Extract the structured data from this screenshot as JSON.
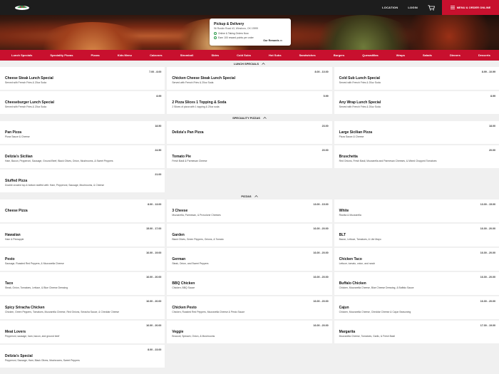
{
  "header": {
    "nav": [
      "LOCATION",
      "LOGIN"
    ],
    "order_button": "MENU & ORDER ONLINE",
    "icons": {
      "cart": "cart-icon",
      "menu": "menu-lines-icon",
      "logo": "pizza-logo"
    }
  },
  "pickup": {
    "title": "Pickup & Delivery",
    "address": "96 Ruskin Road #3, Winsboro, OK 19999",
    "status": "Online & Taking Orders Now",
    "rewards": "Earn 100 reward points per order",
    "rewards_link": "Our Rewards"
  },
  "categories": [
    "Lunch Specials",
    "Speciality Pizzas",
    "Pizzas",
    "Kids Menu",
    "Calzones",
    "Stromboli",
    "Sides",
    "Cold Subs",
    "Hot Subs",
    "Sandwiches",
    "Burgers",
    "Quesadillas",
    "Wraps",
    "Salads",
    "Dinners",
    "Desserts"
  ],
  "sections": [
    {
      "title": "LUNCH SPECIALS",
      "items": [
        {
          "name": "Cheese Steak Lunch Special",
          "desc": "Served with French Fries & 20oz Soda",
          "price": "7.00 - 8.00"
        },
        {
          "name": "Chicken Cheese Steak Lunch Special",
          "desc": "Served with French Fries & 20oz Soda",
          "price": "8.00 - 10.00"
        },
        {
          "name": "Cold Sub Lunch Special",
          "desc": "Served with French Fries & 20oz Soda",
          "price": "8.99 - 10.99"
        },
        {
          "name": "Cheeseburger Lunch Special",
          "desc": "Served with French Fries & 20oz Soda",
          "price": "8.99"
        },
        {
          "name": "2 Pizza Slices 1 Topping & Soda",
          "desc": "2 Slices of pizza with 1 topping & 20oz soda",
          "price": "5.99"
        },
        {
          "name": "Any Wrap Lunch Special",
          "desc": "Served with French Fries & 20oz Soda",
          "price": "8.99"
        }
      ]
    },
    {
      "title": "SPECIALITY PIZZAS",
      "items": [
        {
          "name": "Pan Pizza",
          "desc": "Pizza Sauce & Cheese",
          "price": "18.50"
        },
        {
          "name": "Delizia's Pan Pizza",
          "desc": "",
          "price": "23.00"
        },
        {
          "name": "Large Sicilian Pizza",
          "desc": "Pizza Sauce & Cheese",
          "price": "18.00"
        },
        {
          "name": "Delizia's Sicilian",
          "desc": "Ham, Bacon, Pepperoni, Sausage, Ground Beef, Black Olives, Onion, Mushrooms, & Sweet Peppers",
          "price": "24.50"
        },
        {
          "name": "Tomato Pie",
          "desc": "Fresh Basil & Parmesan Cheese",
          "price": "20.00"
        },
        {
          "name": "Bruschetta",
          "desc": "Red Onions, Fresh Basil, Mozzarella and Parmesan Cheeses, & Mixed Chopped Tomatoes",
          "price": "20.00"
        },
        {
          "name": "Stuffed Pizza",
          "desc": "Double crusted top & bottom stuffed with: Ham, Pepperoni, Sausage, Mushrooms, & Cheese",
          "price": "21.00"
        }
      ]
    },
    {
      "title": "PIZZAS",
      "items": [
        {
          "name": "Cheese Pizza",
          "desc": "",
          "price": "8.00 - 13.00"
        },
        {
          "name": "3 Cheese",
          "desc": "Mozzarella, Parmesan, & Provolone Cheeses",
          "price": "13.00 - 15.00"
        },
        {
          "name": "White",
          "desc": "Ricotta & Mozzarella",
          "price": "13.00 - 15.00"
        },
        {
          "name": "Hawaiian",
          "desc": "Ham & Pineapple",
          "price": "15.00 - 17.00"
        },
        {
          "name": "Garden",
          "desc": "Black Olives, Green Peppers, Onions, & Tomato",
          "price": "16.00 - 20.00"
        },
        {
          "name": "BLT",
          "desc": "Bacon, Lettuce, Tomatoes, & Lite Mayo",
          "price": "16.00 - 20.00"
        },
        {
          "name": "Pesto",
          "desc": "Sausage, Roasted Red Peppers, & Mozzarella Cheese",
          "price": "16.00 - 19.00"
        },
        {
          "name": "German",
          "desc": "Steak, Onion, and Sweet Peppers",
          "price": "16.00 - 20.00"
        },
        {
          "name": "Chicken Taco",
          "desc": "Lettuce, tomato, onion, and ranch",
          "price": "16.00 - 20.00"
        },
        {
          "name": "Taco",
          "desc": "Steak, Onion, Tomatoes, Lettuce, & Blue Cheese Dressing",
          "price": "16.00 - 20.00"
        },
        {
          "name": "BBQ Chicken",
          "desc": "Chicken, BBQ Sauce",
          "price": "16.00 - 20.00"
        },
        {
          "name": "Buffalo Chicken",
          "desc": "Chicken, Mozzarella Cheese, Blue Cheese Dressing, & Buffalo Sauce",
          "price": "16.00 - 20.00"
        },
        {
          "name": "Spicy Sriracha Chicken",
          "desc": "Chicken, Green Peppers, Tomatoes, Mozzarella Cheese, Red Onions, Sriracha Sauce, & Cheddar Cheese",
          "price": "16.00 - 20.00"
        },
        {
          "name": "Chicken Pesto",
          "desc": "Chicken, Roasted Red Peppers, Mozzarella Cheese & Pesto Sauce",
          "price": "16.00 - 20.00"
        },
        {
          "name": "Cajun",
          "desc": "Chicken, Mozzarella Cheese, Cheddar Cheese & Cajun Seasoning",
          "price": "16.00 - 20.00"
        },
        {
          "name": "Meat Lovers",
          "desc": "Pepperoni, sausage, ham, bacon, and ground beef",
          "price": "16.00 - 20.00"
        },
        {
          "name": "Veggie",
          "desc": "Broccoli, Spinach, Onion, & Mushrooms",
          "price": "16.00 - 20.00"
        },
        {
          "name": "Margarita",
          "desc": "Mozzarella Cheese, Tomatoes, Garlic, & Fresh Basil",
          "price": "17.00 - 19.00"
        },
        {
          "name": "Delizia's Special",
          "desc": "Pepperoni, Sausage, Ham, Black Olives, Mushrooms, Sweet Peppers",
          "price": "8.00 - 23.00"
        }
      ]
    }
  ],
  "colors": {
    "brand_red": "#c8102e",
    "header_dark": "#1d1d1d",
    "status_green": "#2e9a4a"
  }
}
